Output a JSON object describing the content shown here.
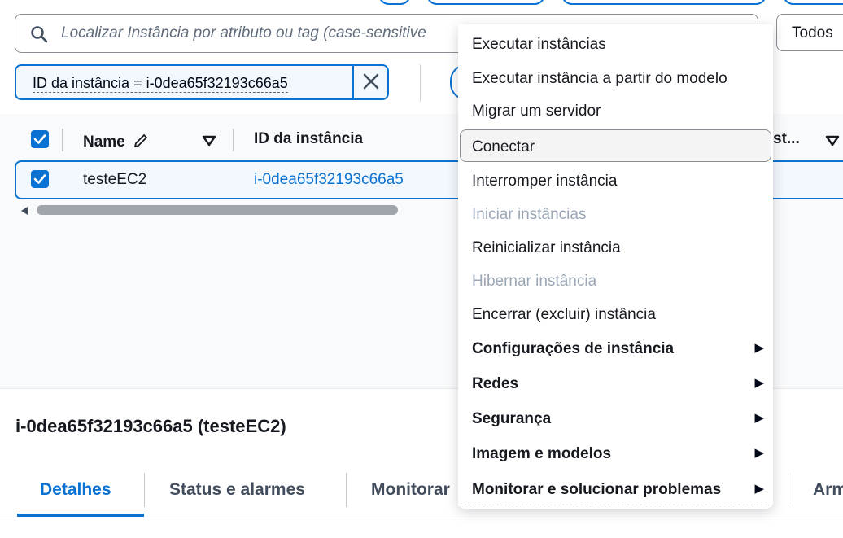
{
  "search": {
    "placeholder": "Localizar Instância por atributo ou tag (case-sensitive"
  },
  "state_filter": {
    "label": "Todos"
  },
  "filter_token": {
    "text": "ID da instância = i-0dea65f32193c66a5"
  },
  "table": {
    "columns": [
      "Name",
      "ID da instância",
      "st..."
    ],
    "rows": [
      {
        "name": "testeEC2",
        "instance_id": "i-0dea65f32193c66a5",
        "selected": true
      }
    ]
  },
  "menu": {
    "items": [
      {
        "label": "Executar instâncias",
        "disabled": false
      },
      {
        "label": "Executar instância a partir do modelo",
        "disabled": false
      },
      {
        "label": "Migrar um servidor",
        "disabled": false
      },
      {
        "label": "Conectar",
        "disabled": false
      },
      {
        "label": "Interromper instância",
        "disabled": false
      },
      {
        "label": "Iniciar instâncias",
        "disabled": true
      },
      {
        "label": "Reinicializar instância",
        "disabled": false
      },
      {
        "label": "Hibernar instância",
        "disabled": true
      },
      {
        "label": "Encerrar (excluir) instância",
        "disabled": false
      }
    ],
    "groups": [
      "Configurações de instância",
      "Redes",
      "Segurança",
      "Imagem e modelos",
      "Monitorar e solucionar problemas"
    ]
  },
  "details": {
    "title": "i-0dea65f32193c66a5 (testeEC2)",
    "tabs": [
      "Detalhes",
      "Status e alarmes",
      "Monitorar",
      "Arm"
    ]
  },
  "colors": {
    "accent": "#0972d3",
    "text": "#16191f",
    "disabled": "#9ba7b6"
  }
}
